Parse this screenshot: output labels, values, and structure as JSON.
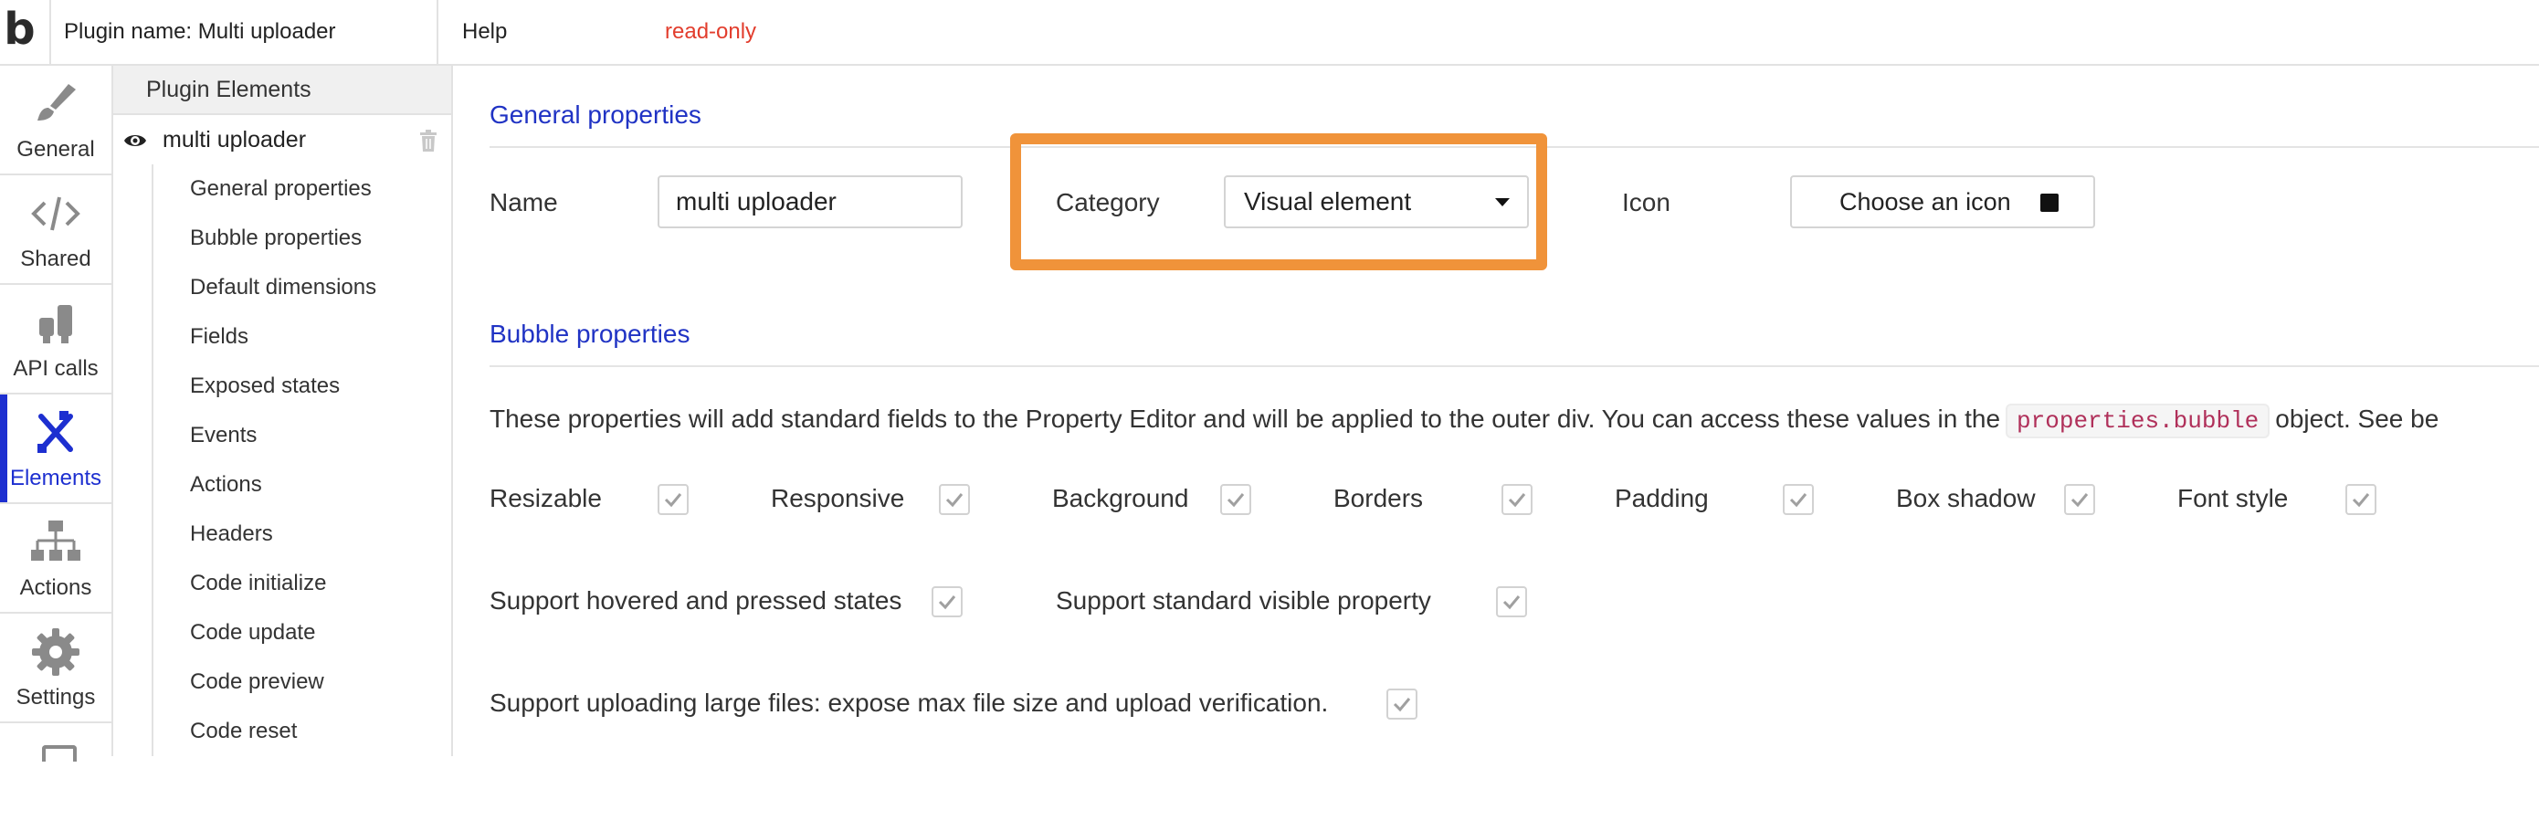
{
  "topbar": {
    "logo": ".b",
    "plugin_name": "Plugin name: Multi uploader",
    "help": "Help",
    "status": "read-only",
    "status_color": "#e23d2d"
  },
  "nav": {
    "accent_color": "#1d2fd0",
    "items": [
      {
        "label": "General",
        "icon": "brush-icon",
        "active": false
      },
      {
        "label": "Shared",
        "icon": "code-icon",
        "active": false
      },
      {
        "label": "API calls",
        "icon": "plug-icon",
        "active": false
      },
      {
        "label": "Elements",
        "icon": "elements-icon",
        "active": true
      },
      {
        "label": "Actions",
        "icon": "workflow-icon",
        "active": false
      },
      {
        "label": "Settings",
        "icon": "gear-icon",
        "active": false
      }
    ]
  },
  "tree": {
    "title": "Plugin Elements",
    "root": "multi uploader",
    "items": [
      "General properties",
      "Bubble properties",
      "Default dimensions",
      "Fields",
      "Exposed states",
      "Events",
      "Actions",
      "Headers",
      "Code initialize",
      "Code update",
      "Code preview",
      "Code reset"
    ]
  },
  "general": {
    "title": "General properties",
    "name_label": "Name",
    "name_value": "multi uploader",
    "category_label": "Category",
    "category_value": "Visual element",
    "icon_label": "Icon",
    "choose_icon": "Choose an icon",
    "highlight_color": "#f0933a"
  },
  "bubble": {
    "title": "Bubble properties",
    "description_pre": "These properties will add standard fields to the Property Editor and will be applied to the outer div. You can access these values in the",
    "description_code": "properties.bubble",
    "description_post": "object. See be",
    "row1": [
      {
        "label": "Resizable",
        "checked": true
      },
      {
        "label": "Responsive",
        "checked": true
      },
      {
        "label": "Background",
        "checked": true
      },
      {
        "label": "Borders",
        "checked": true
      },
      {
        "label": "Padding",
        "checked": true
      },
      {
        "label": "Box shadow",
        "checked": true
      },
      {
        "label": "Font style",
        "checked": true
      }
    ],
    "row2": [
      {
        "label": "Support hovered and pressed states",
        "checked": true
      },
      {
        "label": "Support standard visible property",
        "checked": true
      }
    ],
    "row3": [
      {
        "label": "Support uploading large files: expose max file size and upload verification.",
        "checked": true
      }
    ]
  }
}
